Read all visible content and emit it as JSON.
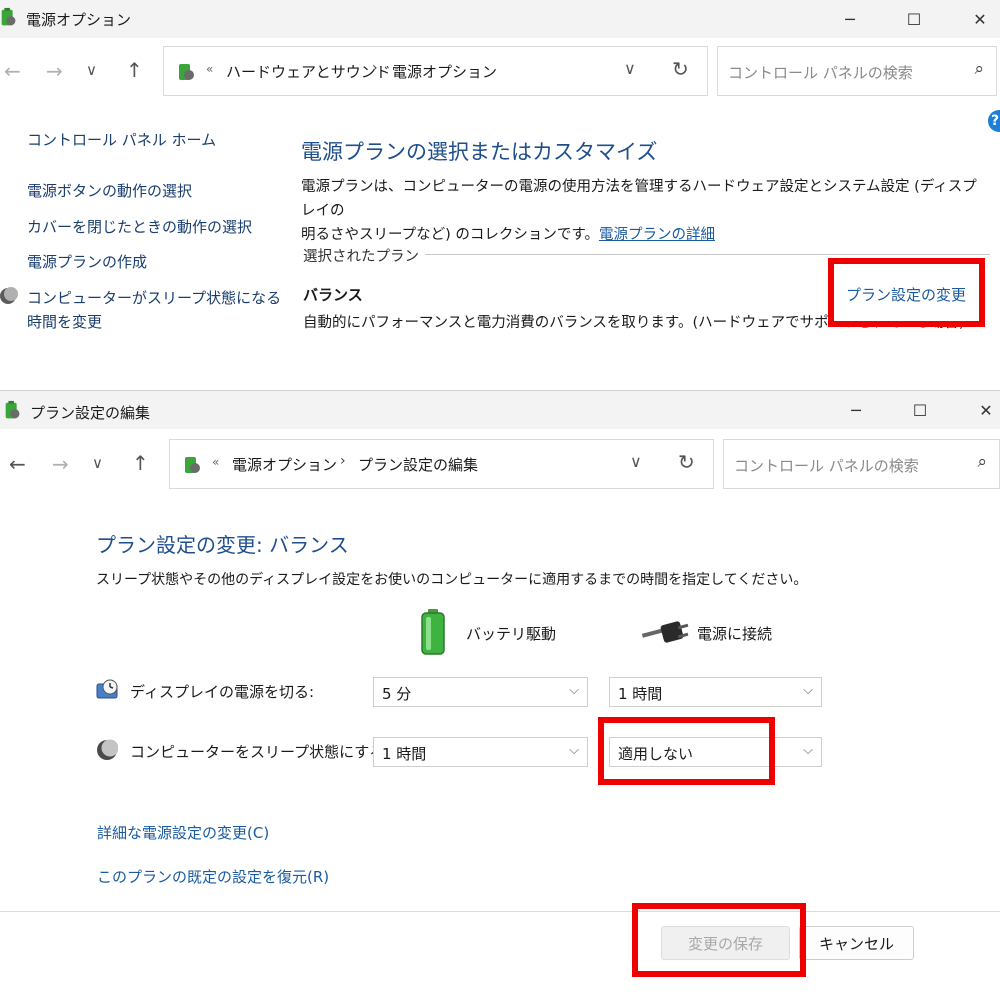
{
  "win1": {
    "title": "電源オプション",
    "controls": {
      "minimize": "─",
      "maximize": "☐",
      "close": "✕"
    },
    "nav": {
      "back": "←",
      "forward": "→",
      "recent": "∨",
      "up": "↑"
    },
    "address": {
      "laquo": "«",
      "crumbs": [
        "ハードウェアとサウンド",
        "電源オプション"
      ],
      "sep": "›",
      "dropdown": "∨",
      "refresh": "↻"
    },
    "search_placeholder": "コントロール パネルの検索",
    "help": "?",
    "sidebar": {
      "home": "コントロール パネル ホーム",
      "items": [
        "電源ボタンの動作の選択",
        "カバーを閉じたときの動作の選択",
        "電源プランの作成",
        "コンピューターがスリープ状態になる",
        "時間を変更"
      ]
    },
    "main": {
      "heading": "電源プランの選択またはカスタマイズ",
      "desc_line1": "電源プランは、コンピューターの電源の使用方法を管理するハードウェア設定とシステム設定 (ディスプレイの",
      "desc_line2": "明るさやスリープなど) のコレクションです。",
      "desc_link": "電源プランの詳細",
      "selected_label": "選択されたプラン",
      "plan_name": "バランス",
      "plan_desc": "自動的にパフォーマンスと電力消費のバランスを取ります。(ハードウェアでサポートされている場合)",
      "change_link": "プラン設定の変更"
    }
  },
  "win2": {
    "title": "プラン設定の編集",
    "controls": {
      "minimize": "─",
      "maximize": "☐",
      "close": "✕"
    },
    "nav": {
      "back": "←",
      "forward": "→",
      "recent": "∨",
      "up": "↑"
    },
    "address": {
      "laquo": "«",
      "crumbs": [
        "電源オプション",
        "プラン設定の編集"
      ],
      "sep": "›",
      "dropdown": "∨",
      "refresh": "↻"
    },
    "search_placeholder": "コントロール パネルの検索",
    "heading": "プラン設定の変更: バランス",
    "instruction": "スリープ状態やその他のディスプレイ設定をお使いのコンピューターに適用するまでの時間を指定してください。",
    "columns": {
      "battery": "バッテリ駆動",
      "plugged": "電源に接続"
    },
    "settings": [
      {
        "label": "ディスプレイの電源を切る:",
        "battery": "5 分",
        "plugged": "1 時間"
      },
      {
        "label": "コンピューターをスリープ状態にする:",
        "battery": "1 時間",
        "plugged": "適用しない"
      }
    ],
    "select_chevron": "⌵",
    "advanced_link": "詳細な電源設定の変更(C)",
    "restore_link": "このプランの既定の設定を復元(R)",
    "save_button": "変更の保存",
    "cancel_button": "キャンセル"
  },
  "colors": {
    "highlight": "#ee0000",
    "link": "#1a5aa0",
    "heading": "#1e4e8c",
    "titlebar": "#f3f3f3"
  }
}
